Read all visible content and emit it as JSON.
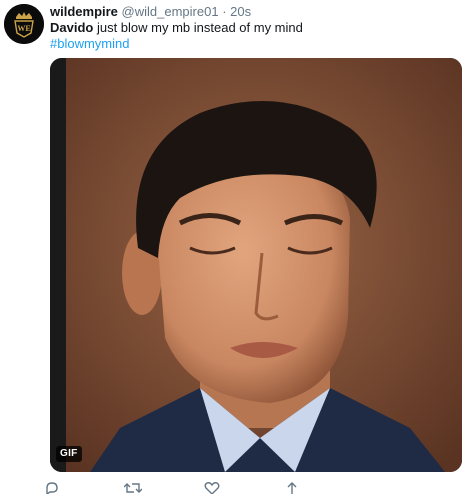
{
  "tweet": {
    "author_name": "wildempire",
    "handle": "@wild_empire01",
    "separator": "·",
    "time": "20s",
    "text_bold": "Davido",
    "text_rest": " just blow my mb instead of my mind",
    "hashtag": "#blowmymind",
    "media_badge": "GIF"
  },
  "colors": {
    "hashtag": "#1da1f2",
    "meta": "#657786",
    "avatar_bg": "#0b0b0b",
    "avatar_gold": "#c9a24a"
  },
  "actions": [
    {
      "icon": "reply-icon"
    },
    {
      "icon": "retweet-icon"
    },
    {
      "icon": "like-icon"
    },
    {
      "icon": "share-icon"
    }
  ]
}
